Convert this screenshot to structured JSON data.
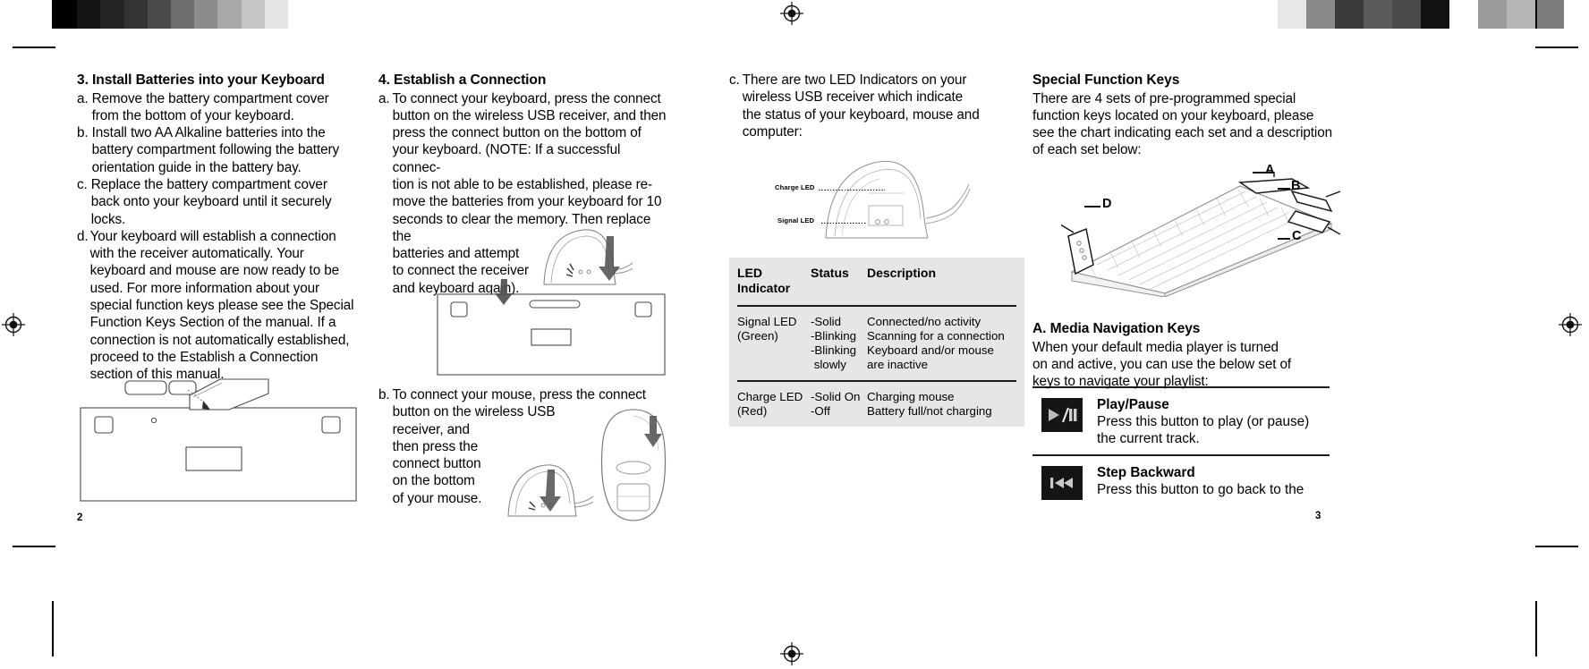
{
  "document": {
    "left_page_number": "2",
    "right_page_number": "3"
  },
  "column1": {
    "heading": "3. Install Batteries into your Keyboard",
    "steps": [
      {
        "mark": "a.",
        "text": "Remove the battery compartment cover from the bottom of your keyboard."
      },
      {
        "mark": "b.",
        "text": "Install two AA Alkaline batteries into the battery compartment following the battery orientation guide in the battery bay."
      },
      {
        "mark": "c.",
        "text": "Replace the battery compartment cover back onto your keyboard until it securely locks."
      },
      {
        "mark": "d.",
        "text": "Your keyboard will establish a connection with the receiver automatically. Your keyboard and mouse are now ready to be used. For more information about your special function keys please see the Special Function Keys Section of the manual.  If a connection is not automatically established, proceed to the Establish a Connection section of this manual."
      }
    ],
    "figure_caption": "keyboard-bottom-battery-cover-illustration"
  },
  "column2": {
    "heading": "4. Establish a Connection",
    "step_a": {
      "mark": "a.",
      "lines": [
        "To connect your keyboard, press the connect",
        "button on the wireless USB receiver, and then",
        "press the connect button on the bottom of",
        "your keyboard. (NOTE: If a successful connec-",
        "tion is not able to be established, please re-",
        "move the batteries from your keyboard for 10",
        "seconds to clear the memory. Then replace the",
        "batteries and attempt",
        "to connect the receiver",
        "and keyboard again)."
      ]
    },
    "step_b": {
      "mark": "b.",
      "lines": [
        "To connect your mouse, press the connect",
        "button on the wireless USB",
        "receiver, and",
        "then press the",
        "connect button",
        "on the bottom",
        "of your mouse."
      ]
    }
  },
  "column3": {
    "step_c": {
      "mark": "c.",
      "lines": [
        "There are two LED Indicators on your",
        "wireless USB receiver which indicate",
        "the status of your keyboard, mouse and",
        "computer:"
      ]
    },
    "receiver_callouts": [
      {
        "label": "Charge LED"
      },
      {
        "label": "Signal LED"
      }
    ],
    "table": {
      "headers": [
        "LED Indicator",
        "Status",
        "Description"
      ],
      "header_cells": [
        [
          "LED",
          "Indicator"
        ],
        [
          "Status"
        ],
        [
          "Description"
        ]
      ],
      "rows": [
        {
          "indicator": [
            "Signal LED",
            "(Green)"
          ],
          "status": [
            "-Solid",
            "-Blinking",
            "-Blinking",
            " slowly"
          ],
          "description": [
            "Connected/no activity",
            "Scanning for a connection",
            "Keyboard and/or mouse",
            "are inactive"
          ]
        },
        {
          "indicator": [
            "Charge LED",
            "(Red)"
          ],
          "status": [
            "-Solid On",
            "-Off"
          ],
          "description": [
            "Charging mouse",
            "Battery full/not charging"
          ]
        }
      ]
    }
  },
  "column4": {
    "heading": "Special Function Keys",
    "intro_lines": [
      "There are 4 sets of pre-programmed special",
      "function keys located on your keyboard, please",
      "see the chart indicating each set and a description",
      "of each set below:"
    ],
    "keyboard_labels": [
      "A",
      "B",
      "C",
      "D"
    ],
    "subheading": "A. Media Navigation Keys",
    "sub_lines": [
      "When your default media player is turned",
      "on and active, you can use the below set of",
      "keys to navigate your playlist:"
    ],
    "media_keys": [
      {
        "icon": "play-pause-icon",
        "title": "Play/Pause",
        "lines": [
          "Press this button to play (or pause)",
          "the current track."
        ]
      },
      {
        "icon": "step-backward-icon",
        "title": "Step Backward",
        "lines": [
          "Press this button to go back to the"
        ]
      }
    ]
  },
  "print_marks": {
    "colorbar_left": [
      "#000000",
      "#141414",
      "#242424",
      "#333333",
      "#4a4a4a",
      "#6e6e6e",
      "#8c8c8c",
      "#a8a8a8",
      "#c6c6c6",
      "#e6e6e6",
      "#ffffff"
    ],
    "colorbar_right": [
      "#e8e8e8",
      "#8a8a8a",
      "#3a3a3a",
      "#5a5a5a",
      "#4a4a4a",
      "#111111",
      "#ffffff",
      "#9a9a9a",
      "#b6b6b6",
      "#7c7c7c"
    ],
    "registration": "crosshair-target-icon"
  }
}
